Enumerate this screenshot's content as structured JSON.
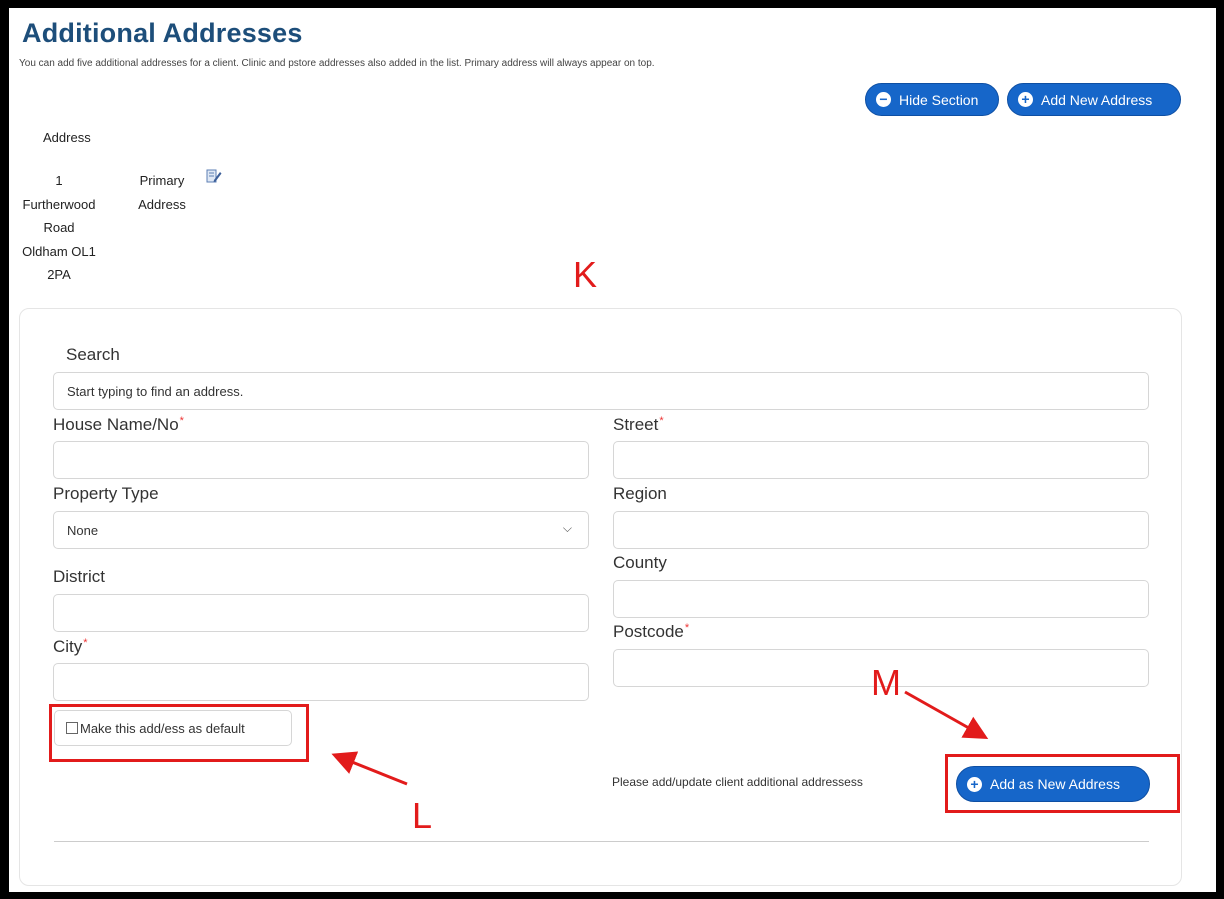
{
  "header": {
    "title": "Additional Addresses",
    "subtitle": "You can add five additional addresses for a client. Clinic and pstore addresses also added in the list. Primary address will always appear on top."
  },
  "buttons": {
    "hide_section": "Hide Section",
    "add_new_address": "Add New Address",
    "add_as_new_address": "Add as New Address"
  },
  "address_list": {
    "column_header": "Address",
    "rows": [
      {
        "address": "1\nFurtherwood\nRoad\nOldham OL1\n2PA",
        "type": "Primary\nAddress"
      }
    ]
  },
  "annotations": {
    "k": "K",
    "l": "L",
    "m": "M"
  },
  "form": {
    "search_label": "Search",
    "search_placeholder": "Start typing to find an address.",
    "house_label": "House Name/No",
    "street_label": "Street",
    "property_type_label": "Property Type",
    "property_type_value": "None",
    "region_label": "Region",
    "district_label": "District",
    "county_label": "County",
    "city_label": "City",
    "postcode_label": "Postcode",
    "required_mark": "*",
    "default_checkbox_label": "Make this add/ess as default",
    "note": "Please add/update client additional addressess"
  },
  "colors": {
    "accent": "#1666c9",
    "title": "#1d4e7a",
    "annotation": "#e21b1b"
  }
}
